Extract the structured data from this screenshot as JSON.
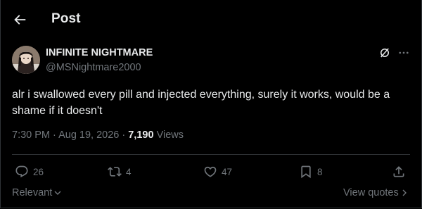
{
  "header": {
    "title": "Post",
    "back_icon": "arrow-left-icon"
  },
  "author": {
    "name": "INFINITE NIGHTMARE",
    "handle": "@MSNightmare2000"
  },
  "post": {
    "text": "alr i swallowed every pill and injected everything, surely it works, would be a shame if it doesn't",
    "time": "7:30 PM",
    "date": "Aug 19, 2026",
    "views_count": "7,190",
    "views_label": "Views"
  },
  "actions": {
    "replies": "26",
    "reposts": "4",
    "likes": "47",
    "bookmarks": "8"
  },
  "footer": {
    "sort_label": "Relevant",
    "view_quotes": "View quotes"
  },
  "colors": {
    "background": "#000000",
    "text": "#e7e9ea",
    "muted": "#71767b",
    "border": "#2f3336"
  }
}
